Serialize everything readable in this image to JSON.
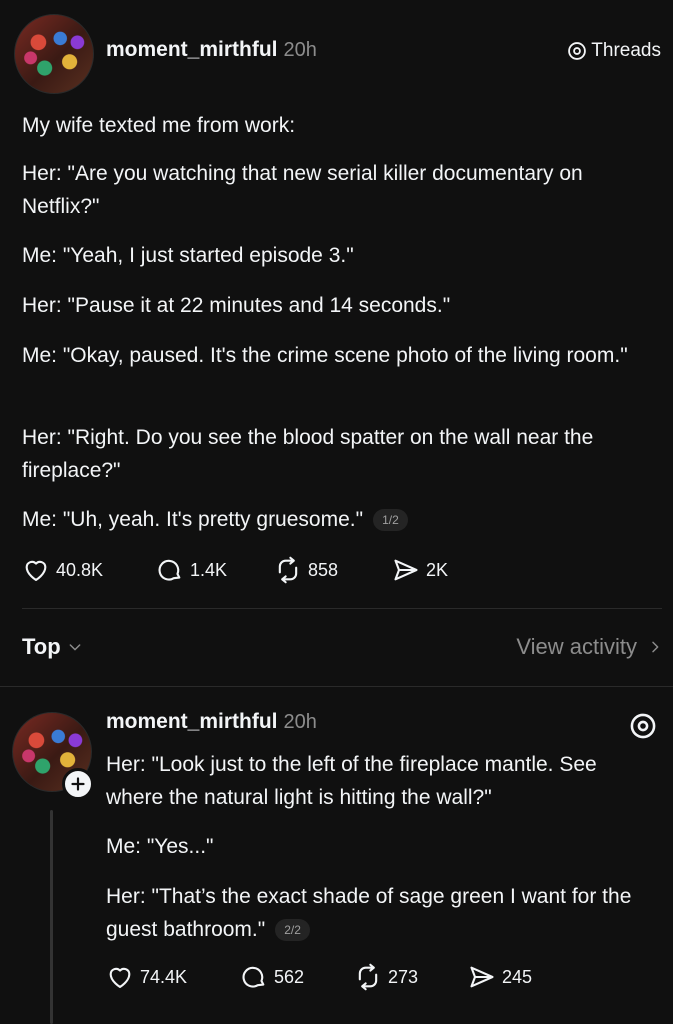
{
  "post": {
    "username": "moment_mirthful",
    "time": "20h",
    "brand": "Threads",
    "paragraphs": [
      "My wife texted me from work:",
      "Her: \"Are you watching that new serial killer documentary on Netflix?\"",
      "Me: \"Yeah, I just started episode 3.\"",
      "Her: \"Pause it at 22 minutes and 14 seconds.\"",
      "Me: \"Okay, paused. It's the crime scene photo of the living room.\"",
      "Her: \"Right. Do you see the blood spatter on the wall near the fireplace?\"",
      "Me: \"Uh, yeah. It's pretty gruesome.\""
    ],
    "pager": "1/2",
    "stats": {
      "likes": "40.8K",
      "comments": "1.4K",
      "reposts": "858",
      "shares": "2K"
    }
  },
  "replies_bar": {
    "sort_label": "Top",
    "activity_label": "View activity"
  },
  "reply": {
    "username": "moment_mirthful",
    "time": "20h",
    "paragraphs": [
      "Her: \"Look just to the left of the fireplace mantle. See where the natural light is hitting the wall?\"",
      "Me: \"Yes...\"",
      "Her: \"That’s the exact shade of sage green I want for the guest bathroom.\""
    ],
    "pager": "2/2",
    "stats": {
      "likes": "74.4K",
      "comments": "562",
      "reposts": "273",
      "shares": "245"
    }
  },
  "colors": {
    "background": "#101010",
    "text": "#f3f5f7",
    "muted": "#8c8c8c"
  }
}
